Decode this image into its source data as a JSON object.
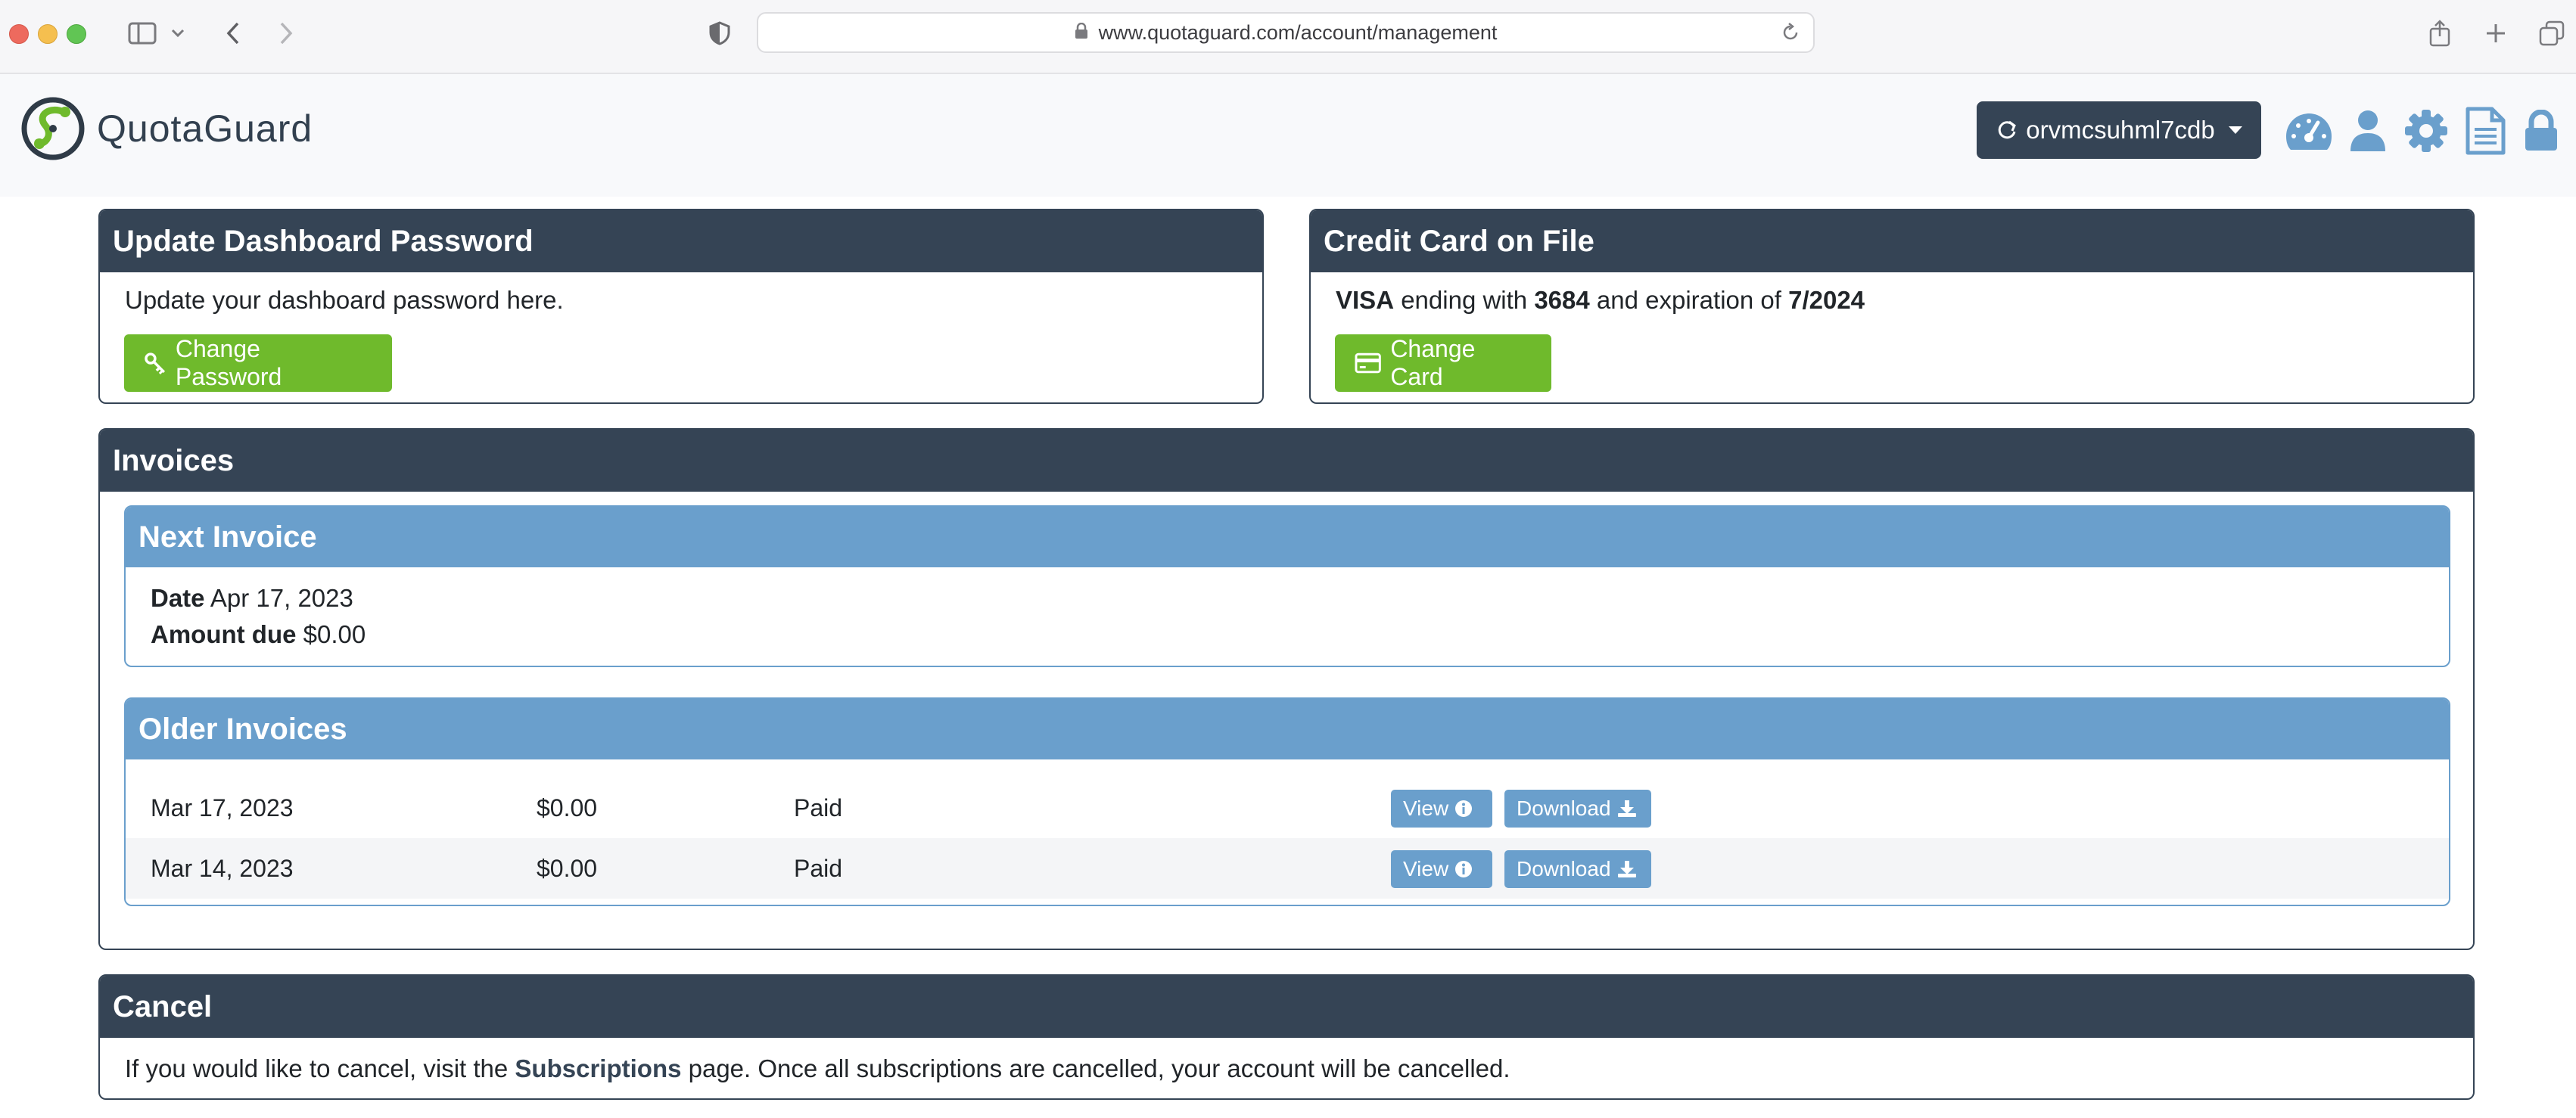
{
  "browser": {
    "url": "www.quotaguard.com/account/management"
  },
  "header": {
    "brand": "QuotaGuard",
    "account_name": "orvmcsuhml7cdb",
    "icons": [
      "dashboard-gauge-icon",
      "user-icon",
      "gear-icon",
      "document-icon",
      "lock-icon"
    ]
  },
  "password_card": {
    "title": "Update Dashboard Password",
    "description": "Update your dashboard password here.",
    "button_label": "Change Password"
  },
  "card_card": {
    "title": "Credit Card on File",
    "brand": "VISA",
    "text_ending": " ending with ",
    "last4": "3684",
    "text_expiration": " and expiration of ",
    "expiration": "7/2024",
    "button_label": "Change Card"
  },
  "invoices": {
    "title": "Invoices",
    "next": {
      "title": "Next Invoice",
      "date_label": "Date",
      "date_value": "Apr 17, 2023",
      "amount_label": "Amount due",
      "amount_value": "$0.00"
    },
    "older": {
      "title": "Older Invoices",
      "view_label": "View",
      "download_label": "Download",
      "rows": [
        {
          "date": "Mar 17, 2023",
          "amount": "$0.00",
          "status": "Paid"
        },
        {
          "date": "Mar 14, 2023",
          "amount": "$0.00",
          "status": "Paid"
        }
      ]
    }
  },
  "cancel": {
    "title": "Cancel",
    "text_before": "If you would like to cancel, visit the ",
    "link_label": "Subscriptions",
    "text_after": " page. Once all subscriptions are cancelled, your account will be cancelled."
  },
  "colors": {
    "dark_navy": "#354455",
    "green": "#6fba2c",
    "light_blue": "#6a9fcc"
  }
}
